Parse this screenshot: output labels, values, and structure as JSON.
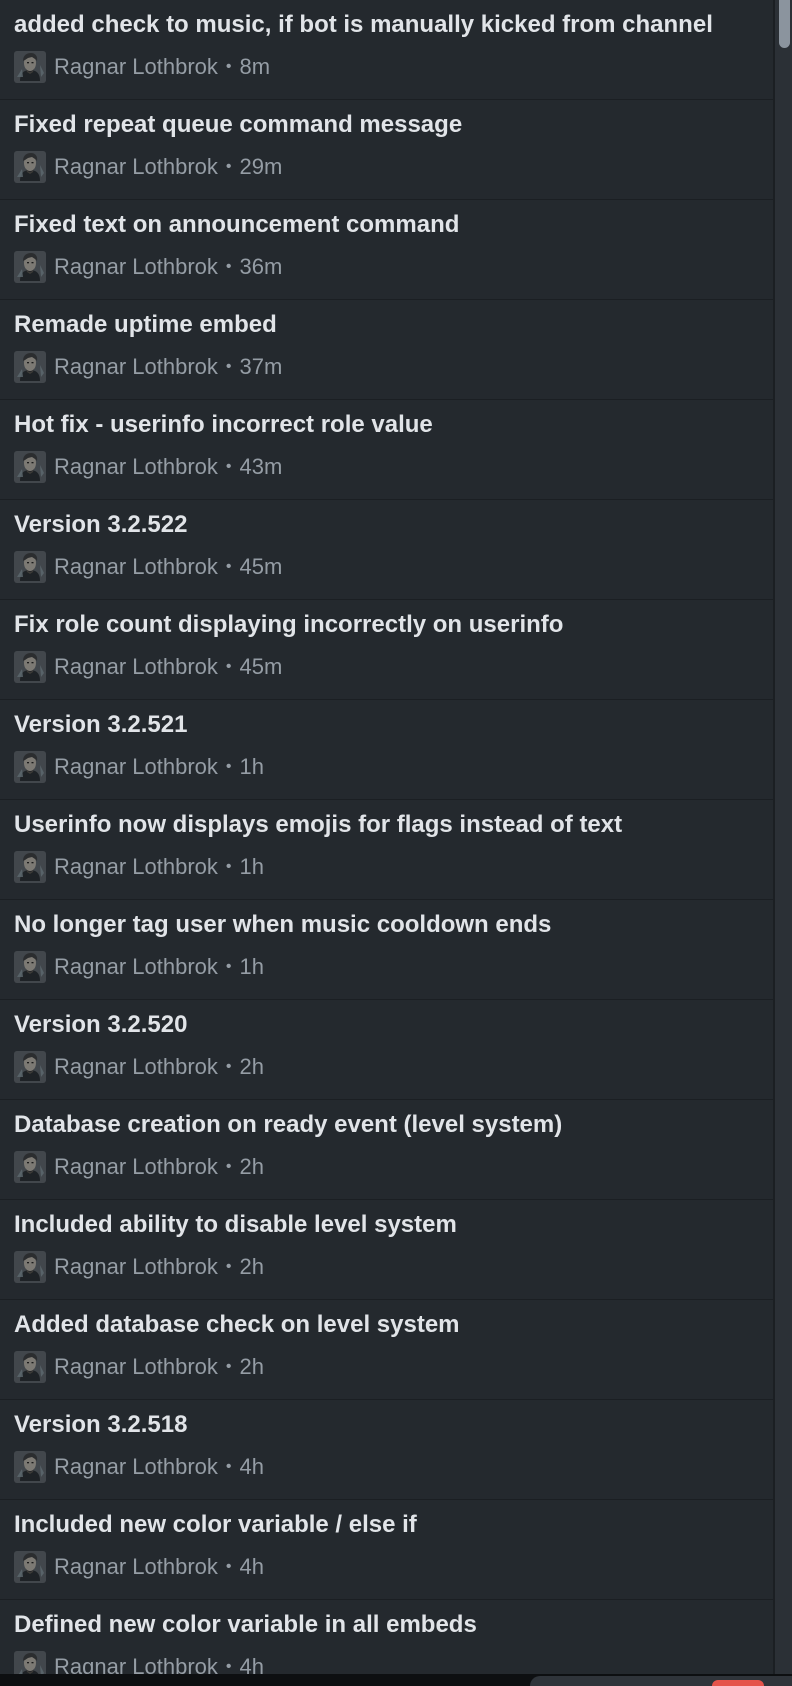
{
  "colors": {
    "background": "#24292e",
    "divider": "#1b1f23",
    "title_text": "#e1e4e8",
    "meta_text": "#959da5"
  },
  "meta_separator": "•",
  "commits": [
    {
      "message": "added check to music, if bot is manually kicked from channel",
      "author": "Ragnar Lothbrok",
      "time": "8m"
    },
    {
      "message": "Fixed repeat queue command message",
      "author": "Ragnar Lothbrok",
      "time": "29m"
    },
    {
      "message": "Fixed text on announcement command",
      "author": "Ragnar Lothbrok",
      "time": "36m"
    },
    {
      "message": "Remade uptime embed",
      "author": "Ragnar Lothbrok",
      "time": "37m"
    },
    {
      "message": "Hot fix - userinfo incorrect role value",
      "author": "Ragnar Lothbrok",
      "time": "43m"
    },
    {
      "message": "Version 3.2.522",
      "author": "Ragnar Lothbrok",
      "time": "45m"
    },
    {
      "message": "Fix role count displaying incorrectly on userinfo",
      "author": "Ragnar Lothbrok",
      "time": "45m"
    },
    {
      "message": "Version 3.2.521",
      "author": "Ragnar Lothbrok",
      "time": "1h"
    },
    {
      "message": "Userinfo now displays emojis for flags instead of text",
      "author": "Ragnar Lothbrok",
      "time": "1h"
    },
    {
      "message": "No longer tag user when music cooldown ends",
      "author": "Ragnar Lothbrok",
      "time": "1h"
    },
    {
      "message": "Version 3.2.520",
      "author": "Ragnar Lothbrok",
      "time": "2h"
    },
    {
      "message": "Database creation on ready event (level system)",
      "author": "Ragnar Lothbrok",
      "time": "2h"
    },
    {
      "message": "Included ability to disable level system",
      "author": "Ragnar Lothbrok",
      "time": "2h"
    },
    {
      "message": "Added database check on level system",
      "author": "Ragnar Lothbrok",
      "time": "2h"
    },
    {
      "message": "Version 3.2.518",
      "author": "Ragnar Lothbrok",
      "time": "4h"
    },
    {
      "message": "Included new color variable / else if",
      "author": "Ragnar Lothbrok",
      "time": "4h"
    },
    {
      "message": "Defined new color variable in all embeds",
      "author": "Ragnar Lothbrok",
      "time": "4h"
    }
  ]
}
